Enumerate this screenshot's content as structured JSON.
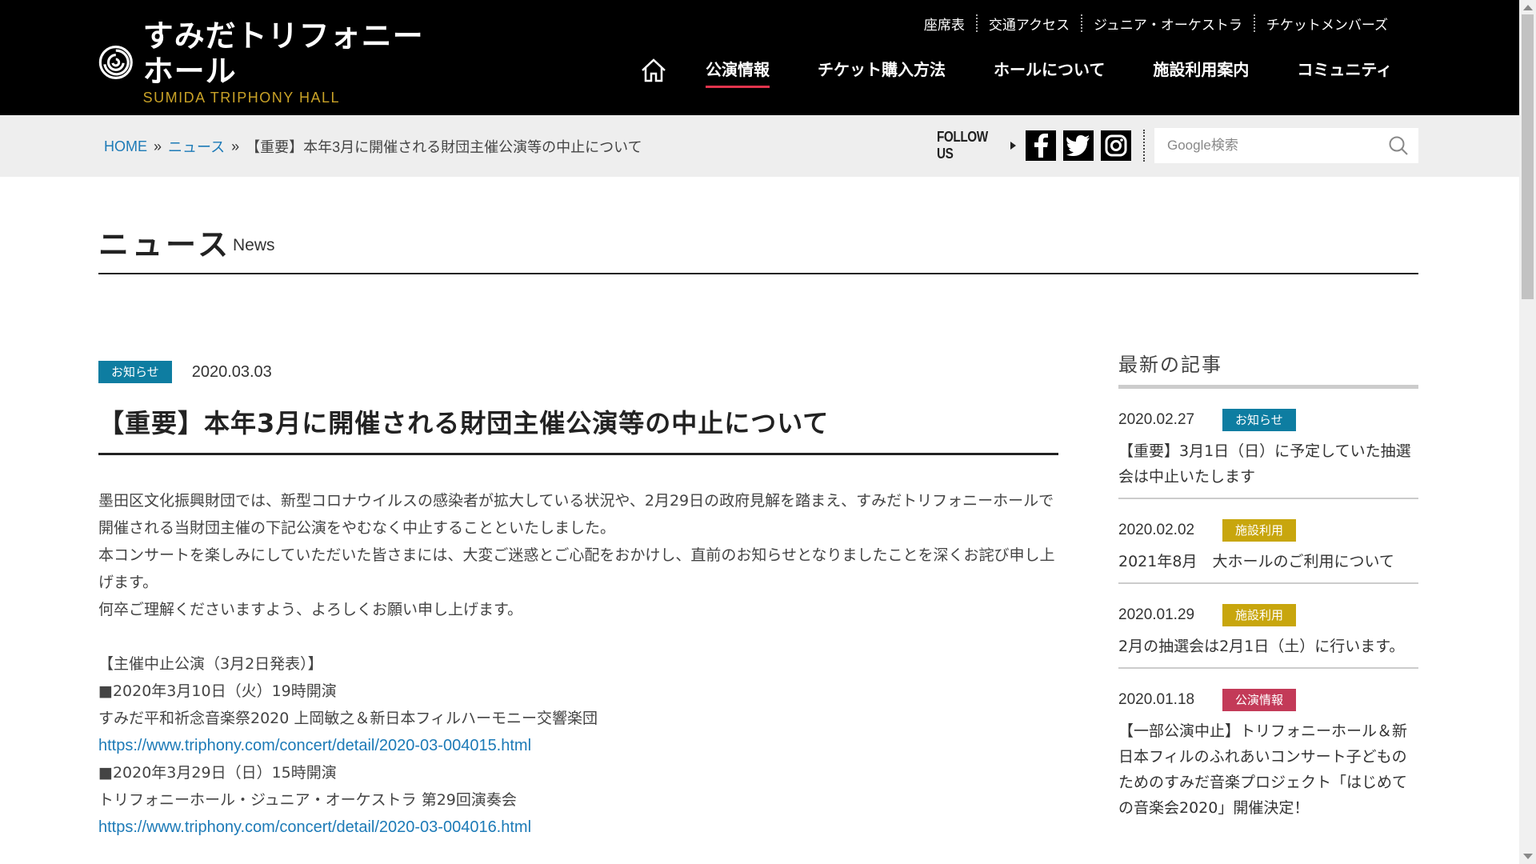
{
  "header": {
    "logo_jp": "すみだトリフォニーホール",
    "logo_en": "SUMIDA TRIPHONY HALL",
    "utility_nav": [
      "座席表",
      "交通アクセス",
      "ジュニア・オーケストラ",
      "チケットメンバーズ"
    ],
    "main_nav": [
      "公演情報",
      "チケット購入方法",
      "ホールについて",
      "施設利用案内",
      "コミュニティ"
    ],
    "active_nav": "公演情報",
    "active_color": "#e2344d"
  },
  "breadcrumb": {
    "home": "HOME",
    "sep": "»",
    "news": "ニュース",
    "current": "【重要】本年3月に開催される財団主催公演等の中止について"
  },
  "follow": {
    "label": "FOLLOW US",
    "icons": [
      "facebook-icon",
      "twitter-icon",
      "instagram-icon"
    ]
  },
  "search": {
    "placeholder": "Google検索"
  },
  "page": {
    "title": "ニュース",
    "subtitle": "News"
  },
  "article": {
    "category": "お知らせ",
    "date": "2020.03.03",
    "title": "【重要】本年3月に開催される財団主催公演等の中止について",
    "p1": "墨田区文化振興財団では、新型コロナウイルスの感染者が拡大している状況や、2月29日の政府見解を踏まえ、すみだトリフォニーホールで開催される当財団主催の下記公演をやむなく中止することといたしました。",
    "p2": "本コンサートを楽しみにしていただいた皆さまには、大変ご迷惑とご心配をおかけし、直前のお知らせとなりましたことを深くお詫び申し上げます。",
    "p3": "何卒ご理解くださいますよう、よろしくお願い申し上げます。",
    "section_title": "【主催中止公演（3月2日発表）】",
    "events": [
      {
        "when": "■2020年3月10日（火）19時開演",
        "name": "すみだ平和祈念音楽祭2020 上岡敏之＆新日本フィルハーモニー交響楽団",
        "url": "https://www.triphony.com/concert/detail/2020-03-004015.html"
      },
      {
        "when": "■2020年3月29日（日）15時開演",
        "name": "トリフォニーホール・ジュニア・オーケストラ 第29回演奏会",
        "url": "https://www.triphony.com/concert/detail/2020-03-004016.html"
      }
    ]
  },
  "sidebar": {
    "title": "最新の記事",
    "items": [
      {
        "date": "2020.02.27",
        "category": "お知らせ",
        "type": "info",
        "text": "【重要】3月1日（日）に予定していた抽選会は中止いたします"
      },
      {
        "date": "2020.02.02",
        "category": "施設利用",
        "type": "facility",
        "text": "2021年8月　大ホールのご利用について"
      },
      {
        "date": "2020.01.29",
        "category": "施設利用",
        "type": "facility",
        "text": "2月の抽選会は2月1日（土）に行います。"
      },
      {
        "date": "2020.01.18",
        "category": "公演情報",
        "type": "concert",
        "text": "【一部公演中止】トリフォニーホール＆新日本フィルのふれあいコンサート子どものためのすみだ音楽プロジェクト「はじめての音楽会2020」開催決定！"
      }
    ]
  },
  "colors": {
    "info": "#0e7da1",
    "facility": "#c8a60d",
    "concert": "#c33a58",
    "link": "#1c7ab7"
  }
}
